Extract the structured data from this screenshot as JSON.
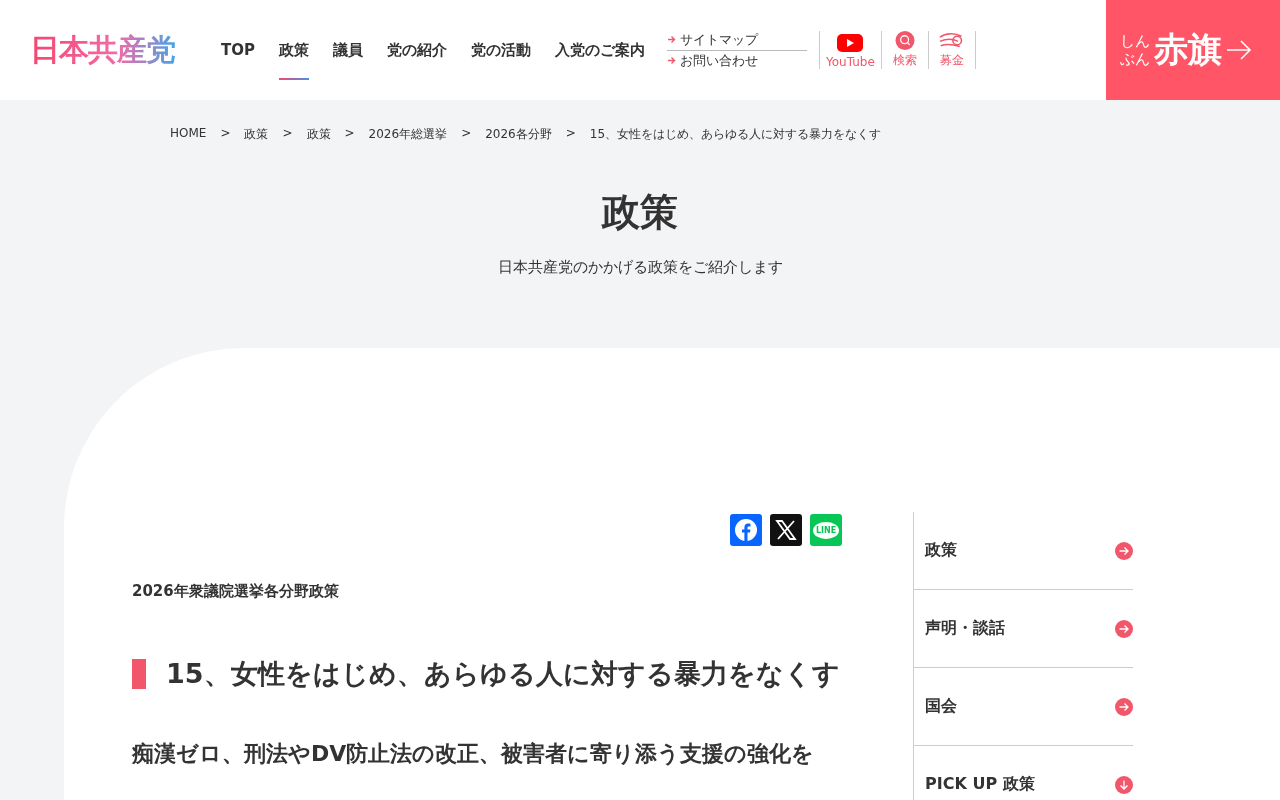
{
  "logo": "日本共産党",
  "nav": [
    {
      "label": "TOP",
      "selected": false
    },
    {
      "label": "政策",
      "selected": true
    },
    {
      "label": "議員",
      "selected": false
    },
    {
      "label": "党の紹介",
      "selected": false
    },
    {
      "label": "党の活動",
      "selected": false
    },
    {
      "label": "入党のご案内",
      "selected": false
    }
  ],
  "sub_links": [
    "サイトマップ",
    "お問い合わせ"
  ],
  "header_icons": [
    {
      "kind": "youtube",
      "label": "YouTube"
    },
    {
      "kind": "search",
      "label": "検索"
    },
    {
      "kind": "donate",
      "label": "募金"
    }
  ],
  "akahata": {
    "small": [
      "しん",
      "ぶん"
    ],
    "title": "赤旗"
  },
  "breadcrumb": [
    "HOME",
    "政策",
    "政策",
    "2026年総選挙",
    "2026各分野",
    "15、女性をはじめ、あらゆる人に対する暴力をなくす"
  ],
  "breadcrumb_separator": ">",
  "page_title": "政策",
  "page_subtitle": "日本共産党のかかげる政策をご紹介します",
  "share": [
    {
      "kind": "facebook"
    },
    {
      "kind": "x"
    },
    {
      "kind": "line",
      "label": "LINE"
    }
  ],
  "category": "2026年衆議院選挙各分野政策",
  "heading": "15、女性をはじめ、あらゆる人に対する暴力をなくす",
  "subheading": "痴漢ゼロ、刑法やDV防止法の改正、被害者に寄り添う支援の強化を",
  "sidebar": [
    {
      "label": "政策",
      "kind": "link"
    },
    {
      "label": "声明・談話",
      "kind": "link"
    },
    {
      "label": "国会",
      "kind": "link"
    },
    {
      "label": "PICK UP 政策",
      "kind": "expand"
    }
  ]
}
